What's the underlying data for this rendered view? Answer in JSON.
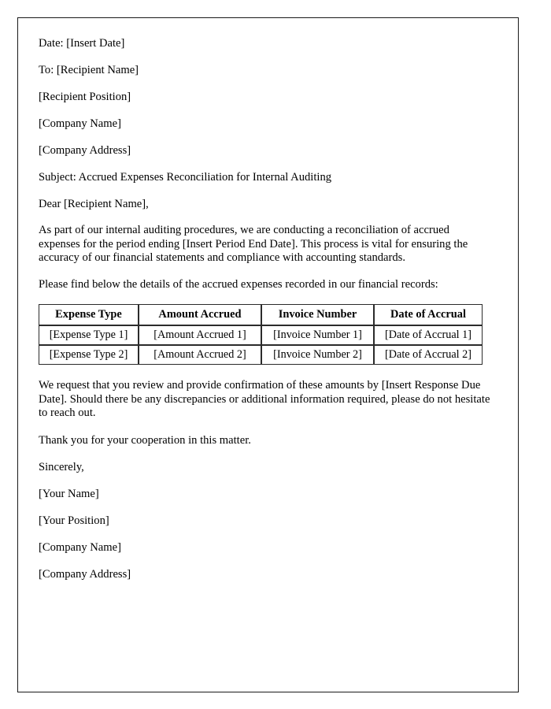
{
  "document": {
    "type": "business-letter",
    "header_lines": [
      "Date: [Insert Date]",
      "To: [Recipient Name]",
      "[Recipient Position]",
      "[Company Name]",
      "[Company Address]"
    ],
    "subject": "Subject: Accrued Expenses Reconciliation for Internal Auditing",
    "salutation": "Dear [Recipient Name],",
    "body_paragraph": "As part of our internal auditing procedures, we are conducting a reconciliation of accrued expenses for the period ending [Insert Period End Date]. This process is vital for ensuring the accuracy of our financial statements and compliance with accounting standards.",
    "table_intro": "Please find below the details of the accrued expenses recorded in our financial records:",
    "table": {
      "headers": [
        "Expense Type",
        "Amount Accrued",
        "Invoice Number",
        "Date of Accrual"
      ],
      "rows": [
        [
          "[Expense Type 1]",
          "[Amount Accrued 1]",
          "[Invoice Number 1]",
          "[Date of Accrual 1]"
        ],
        [
          "[Expense Type 2]",
          "[Amount Accrued 2]",
          "[Invoice Number 2]",
          "[Date of Accrual 2]"
        ]
      ]
    },
    "closing_paragraph": "We request that you review and provide confirmation of these amounts by [Insert Response Due Date]. Should there be any discrepancies or additional information required, please do not hesitate to reach out.",
    "thanks_line": "Thank you for your cooperation in this matter.",
    "sign_off": "Sincerely,",
    "signature_lines": [
      "[Your Name]",
      "[Your Position]",
      "[Company Name]",
      "[Company Address]"
    ]
  },
  "style": {
    "text_color": "#000000",
    "page_background": "#ffffff",
    "border_color": "#1a1a1a",
    "table_border_color": "#2b2b2b"
  }
}
